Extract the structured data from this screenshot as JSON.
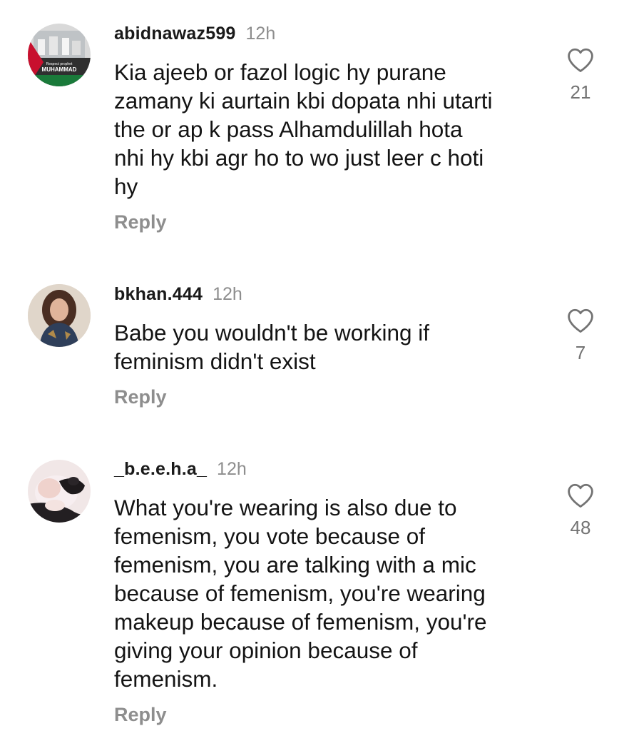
{
  "comments": [
    {
      "username": "abidnawaz599",
      "time": "12h",
      "text": "Kia ajeeb or fazol logic hy purane\nzamany ki aurtain kbi dopata nhi utarti\nthe or ap k pass Alhamdulillah hota\nnhi hy kbi agr ho to wo just leer c hoti\nhy",
      "likes": "21",
      "reply_label": "Reply",
      "avatar_caption_small": "Respect prophet",
      "avatar_caption": "MUHAMMAD"
    },
    {
      "username": "bkhan.444",
      "time": "12h",
      "text": "Babe you wouldn't be working if\nfeminism didn't exist",
      "likes": "7",
      "reply_label": "Reply"
    },
    {
      "username": "_b.e.e.h.a_",
      "time": "12h",
      "text": "What you're wearing is also due to\nfemenism, you vote because of\nfemenism, you are talking with a mic\nbecause of femenism, you're wearing\nmakeup because of femenism, you're\ngiving your opinion because of\nfemenism.",
      "likes": "48",
      "reply_label": "Reply"
    }
  ],
  "icons": {
    "like": "heart-outline-icon"
  },
  "colors": {
    "username": "#1a1a1a",
    "secondary_text": "#8e8e8e",
    "like_count": "#737373",
    "body_text": "#141414"
  }
}
